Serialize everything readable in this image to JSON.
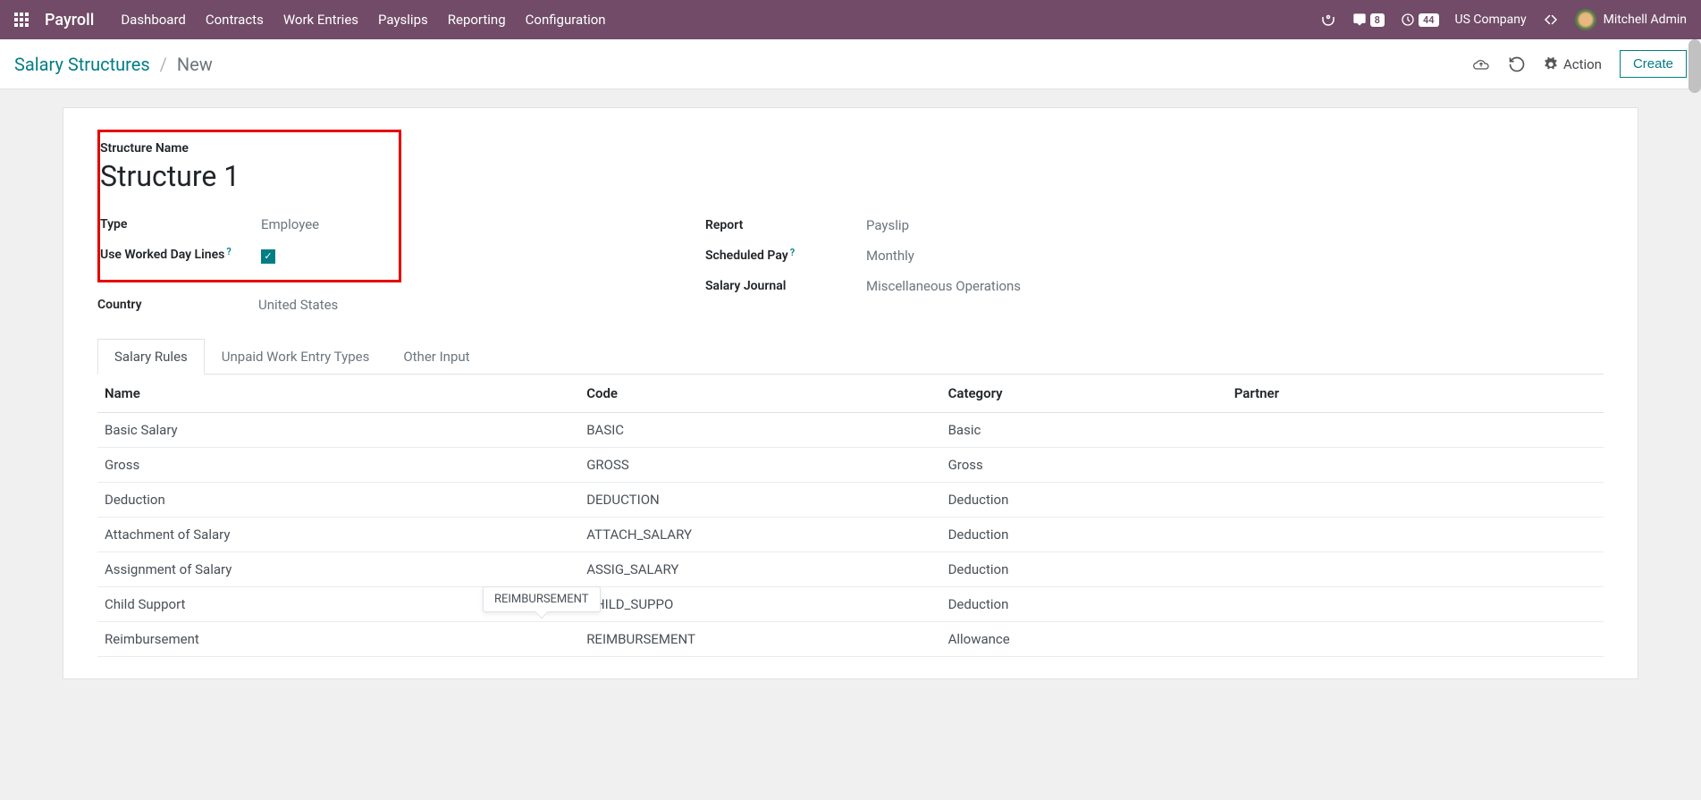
{
  "navbar": {
    "app_title": "Payroll",
    "menu": [
      "Dashboard",
      "Contracts",
      "Work Entries",
      "Payslips",
      "Reporting",
      "Configuration"
    ],
    "messages_count": "8",
    "activities_count": "44",
    "company": "US Company",
    "user": "Mitchell Admin"
  },
  "breadcrumb": {
    "parent": "Salary Structures",
    "current": "New"
  },
  "cp_buttons": {
    "action": "Action",
    "create": "Create"
  },
  "form": {
    "structure_name_label": "Structure Name",
    "structure_name_value": "Structure 1",
    "left": {
      "type_label": "Type",
      "type_value": "Employee",
      "worked_day_label": "Use Worked Day Lines",
      "worked_day_checked": true,
      "country_label": "Country",
      "country_value": "United States"
    },
    "right": {
      "report_label": "Report",
      "report_value": "Payslip",
      "scheduled_pay_label": "Scheduled Pay",
      "scheduled_pay_value": "Monthly",
      "salary_journal_label": "Salary Journal",
      "salary_journal_value": "Miscellaneous Operations"
    }
  },
  "tabs": [
    "Salary Rules",
    "Unpaid Work Entry Types",
    "Other Input"
  ],
  "table": {
    "headers": [
      "Name",
      "Code",
      "Category",
      "Partner"
    ],
    "rows": [
      {
        "name": "Basic Salary",
        "code": "BASIC",
        "category": "Basic",
        "partner": ""
      },
      {
        "name": "Gross",
        "code": "GROSS",
        "category": "Gross",
        "partner": ""
      },
      {
        "name": "Deduction",
        "code": "DEDUCTION",
        "category": "Deduction",
        "partner": ""
      },
      {
        "name": "Attachment of Salary",
        "code": "ATTACH_SALARY",
        "category": "Deduction",
        "partner": ""
      },
      {
        "name": "Assignment of Salary",
        "code": "ASSIG_SALARY",
        "category": "Deduction",
        "partner": ""
      },
      {
        "name": "Child Support",
        "code": "CHILD_SUPPO",
        "category": "Deduction",
        "partner": ""
      },
      {
        "name": "Reimbursement",
        "code": "REIMBURSEMENT",
        "category": "Allowance",
        "partner": ""
      }
    ]
  },
  "tooltip": "REIMBURSEMENT"
}
